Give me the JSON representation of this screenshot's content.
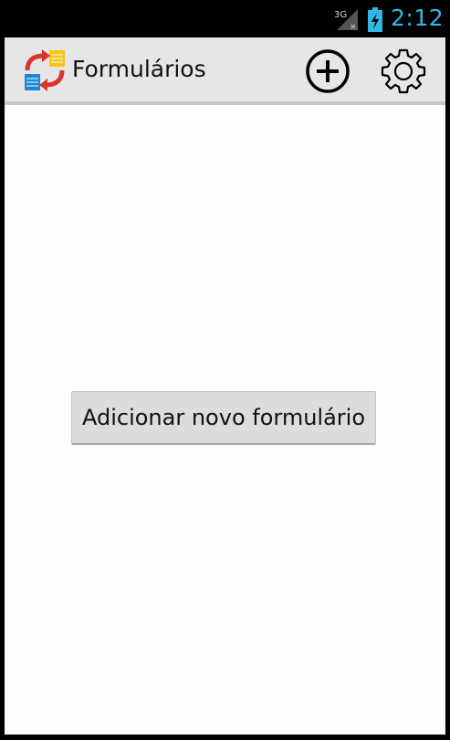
{
  "status_bar": {
    "network_type": "3G",
    "time": "2:12",
    "signal_icon": "signal-no-data-icon",
    "battery_icon": "battery-charging-icon",
    "clock_color": "#33b5e5"
  },
  "action_bar": {
    "title": "Formulários",
    "app_icon": "sync-forms-icon",
    "actions": [
      {
        "name": "add",
        "icon": "plus-circle-icon"
      },
      {
        "name": "settings",
        "icon": "gear-icon"
      }
    ]
  },
  "content": {
    "add_form_button_label": "Adicionar novo formulário"
  }
}
